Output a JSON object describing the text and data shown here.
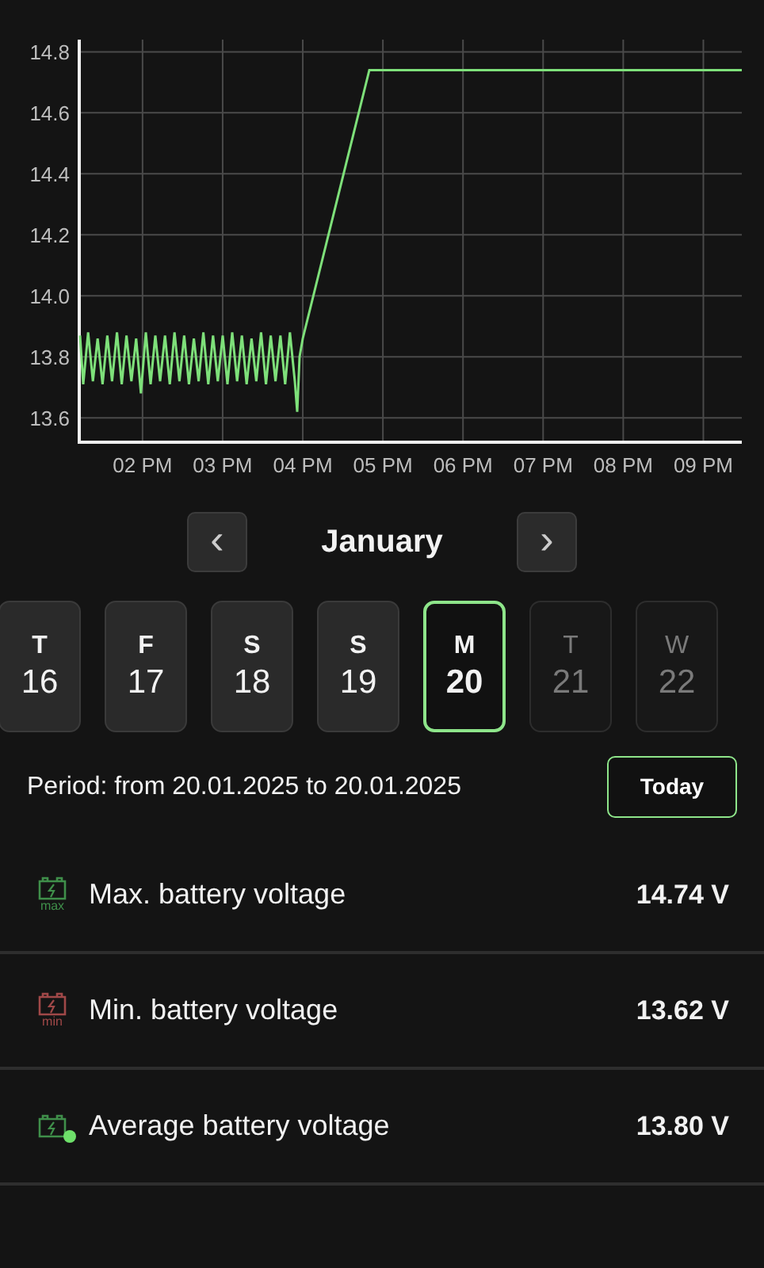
{
  "chart_data": {
    "type": "line",
    "grid": true,
    "x": [
      1.22,
      1.26,
      1.32,
      1.38,
      1.44,
      1.5,
      1.56,
      1.62,
      1.68,
      1.74,
      1.8,
      1.86,
      1.92,
      1.98,
      2.04,
      2.1,
      2.16,
      2.22,
      2.28,
      2.34,
      2.4,
      2.46,
      2.52,
      2.58,
      2.64,
      2.7,
      2.76,
      2.82,
      2.88,
      2.94,
      3.0,
      3.06,
      3.12,
      3.18,
      3.24,
      3.3,
      3.36,
      3.42,
      3.48,
      3.54,
      3.6,
      3.66,
      3.72,
      3.78,
      3.84,
      3.9,
      3.93,
      3.96,
      4.0,
      4.83,
      9.48
    ],
    "series": [
      {
        "color": "#7ee07a",
        "values": [
          13.87,
          13.71,
          13.88,
          13.72,
          13.86,
          13.71,
          13.87,
          13.72,
          13.88,
          13.71,
          13.87,
          13.72,
          13.86,
          13.68,
          13.88,
          13.71,
          13.87,
          13.72,
          13.87,
          13.71,
          13.88,
          13.72,
          13.87,
          13.71,
          13.86,
          13.72,
          13.88,
          13.71,
          13.87,
          13.72,
          13.87,
          13.71,
          13.88,
          13.72,
          13.87,
          13.71,
          13.86,
          13.72,
          13.88,
          13.71,
          13.87,
          13.72,
          13.87,
          13.71,
          13.88,
          13.72,
          13.62,
          13.8,
          13.86,
          14.74,
          14.74
        ]
      }
    ],
    "xlim": [
      1.21,
      9.48
    ],
    "ylim": [
      13.52,
      14.84
    ],
    "xticks": [
      {
        "value": 2,
        "label": "02 PM"
      },
      {
        "value": 3,
        "label": "03 PM"
      },
      {
        "value": 4,
        "label": "04 PM"
      },
      {
        "value": 5,
        "label": "05 PM"
      },
      {
        "value": 6,
        "label": "06 PM"
      },
      {
        "value": 7,
        "label": "07 PM"
      },
      {
        "value": 8,
        "label": "08 PM"
      },
      {
        "value": 9,
        "label": "09 PM"
      }
    ],
    "yticks": [
      {
        "value": 13.6,
        "label": "13.6"
      },
      {
        "value": 13.8,
        "label": "13.8"
      },
      {
        "value": 14.0,
        "label": "14.0"
      },
      {
        "value": 14.2,
        "label": "14.2"
      },
      {
        "value": 14.4,
        "label": "14.4"
      },
      {
        "value": 14.6,
        "label": "14.6"
      },
      {
        "value": 14.8,
        "label": "14.8"
      }
    ]
  },
  "month": {
    "prev": "‹",
    "label": "January",
    "next": "›"
  },
  "days": [
    {
      "letter": "T",
      "number": "16",
      "selected": false,
      "disabled": false
    },
    {
      "letter": "F",
      "number": "17",
      "selected": false,
      "disabled": false
    },
    {
      "letter": "S",
      "number": "18",
      "selected": false,
      "disabled": false
    },
    {
      "letter": "S",
      "number": "19",
      "selected": false,
      "disabled": false
    },
    {
      "letter": "M",
      "number": "20",
      "selected": true,
      "disabled": false
    },
    {
      "letter": "T",
      "number": "21",
      "selected": false,
      "disabled": true
    },
    {
      "letter": "W",
      "number": "22",
      "selected": false,
      "disabled": true
    }
  ],
  "period": "Period: from 20.01.2025 to 20.01.2025",
  "today_button": "Today",
  "metrics": [
    {
      "kind": "max",
      "icon_label": "max",
      "label": "Max. battery voltage",
      "value": "14.74 V",
      "color": "#3f8f4a"
    },
    {
      "kind": "min",
      "icon_label": "min",
      "label": "Min. battery voltage",
      "value": "13.62 V",
      "color": "#a04848"
    },
    {
      "kind": "avg",
      "label": "Average battery voltage",
      "value": "13.80 V",
      "color": "#3f8f4a"
    }
  ]
}
